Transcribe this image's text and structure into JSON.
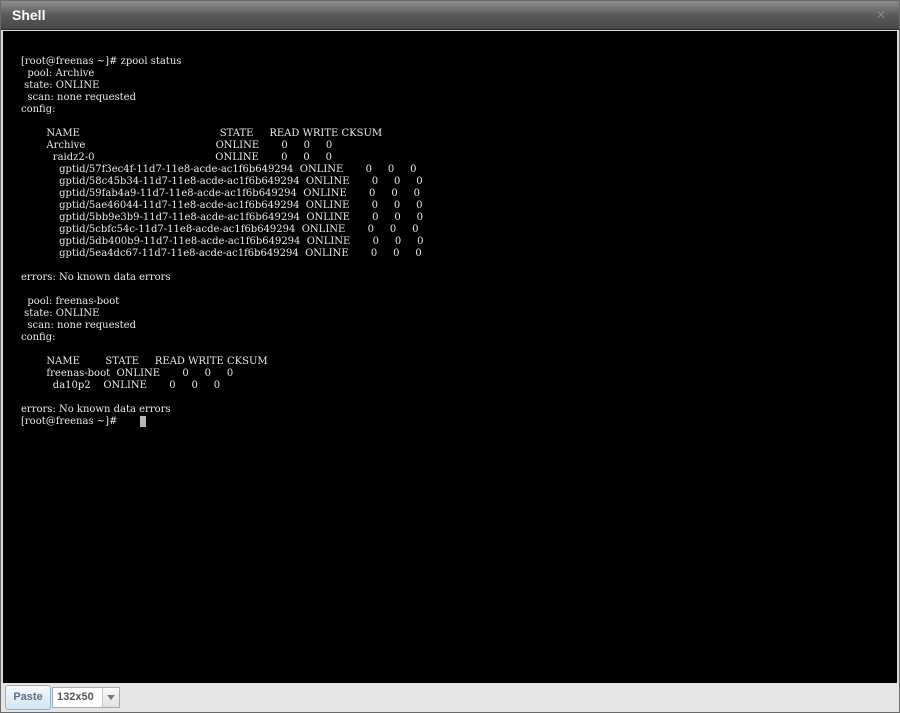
{
  "window": {
    "title": "Shell",
    "close_icon": "✕"
  },
  "terminal": {
    "lines": [
      "[root@freenas ~]# zpool status",
      "  pool: Archive",
      " state: ONLINE",
      "  scan: none requested",
      "config:",
      "",
      "        NAME                                            STATE     READ WRITE CKSUM",
      "        Archive                                         ONLINE       0     0     0",
      "          raidz2-0                                      ONLINE       0     0     0",
      "            gptid/57f3ec4f-11d7-11e8-acde-ac1f6b649294  ONLINE       0     0     0",
      "            gptid/58c45b34-11d7-11e8-acde-ac1f6b649294  ONLINE       0     0     0",
      "            gptid/59fab4a9-11d7-11e8-acde-ac1f6b649294  ONLINE       0     0     0",
      "            gptid/5ae46044-11d7-11e8-acde-ac1f6b649294  ONLINE       0     0     0",
      "            gptid/5bb9e3b9-11d7-11e8-acde-ac1f6b649294  ONLINE       0     0     0",
      "            gptid/5cbfc54c-11d7-11e8-acde-ac1f6b649294  ONLINE       0     0     0",
      "            gptid/5db400b9-11d7-11e8-acde-ac1f6b649294  ONLINE       0     0     0",
      "            gptid/5ea4dc67-11d7-11e8-acde-ac1f6b649294  ONLINE       0     0     0",
      "",
      "errors: No known data errors",
      "",
      "  pool: freenas-boot",
      " state: ONLINE",
      "  scan: none requested",
      "config:",
      "",
      "        NAME        STATE     READ WRITE CKSUM",
      "        freenas-boot  ONLINE       0     0     0",
      "          da10p2    ONLINE       0     0     0",
      "",
      "errors: No known data errors",
      "[root@freenas ~]# "
    ]
  },
  "toolbar": {
    "paste_label": "Paste",
    "size_value": "132x50"
  }
}
